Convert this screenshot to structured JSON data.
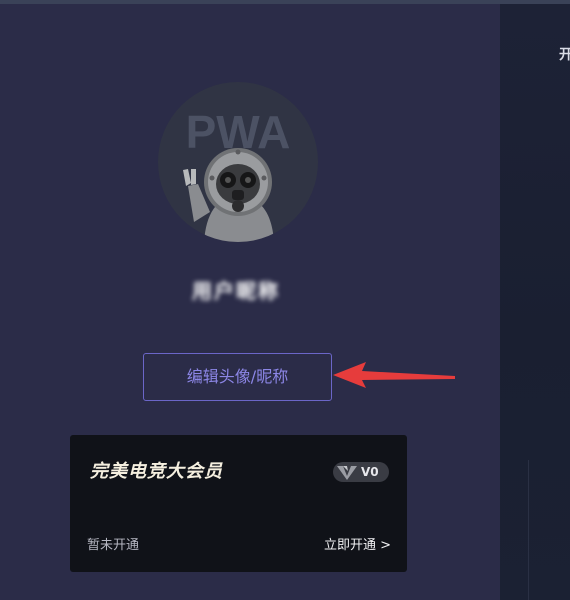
{
  "profile": {
    "avatar_text": "PWA",
    "nickname": "用户昵称",
    "edit_button_label": "编辑头像/昵称"
  },
  "vip": {
    "title": "完美电竞大会员",
    "level_badge": "V0",
    "status": "暂未开通",
    "open_link": "立即开通 >"
  },
  "right_panel": {
    "glyph": "开"
  },
  "colors": {
    "panel_bg": "#2b2c48",
    "accent": "#8c86e6",
    "arrow": "#e63c3c",
    "card_bg": "#101218"
  }
}
